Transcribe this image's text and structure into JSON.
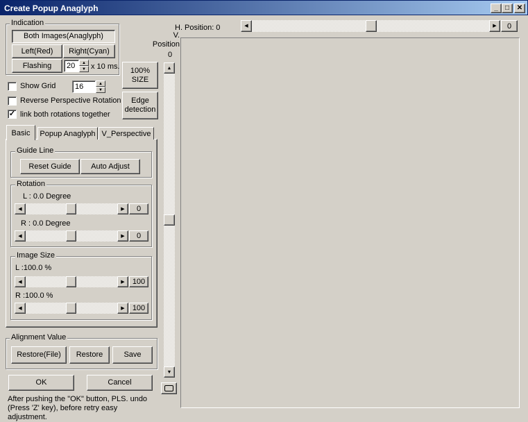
{
  "window": {
    "title": "Create Popup Anaglyph",
    "minimize_glyph": "_",
    "maximize_glyph": "□",
    "close_glyph": "✕"
  },
  "indication": {
    "label": "Indication",
    "both_images": "Both Images(Anaglyph)",
    "left_red": "Left(Red)",
    "right_cyan": "Right(Cyan)",
    "flashing": "Flashing",
    "flash_interval": "20",
    "flash_unit": "x 10 ms."
  },
  "buttons": {
    "size_100": "100% SIZE",
    "edge_detection": "Edge detection",
    "ok": "OK",
    "cancel": "Cancel"
  },
  "options": {
    "show_grid": "Show Grid",
    "show_grid_checked": false,
    "grid_size": "16",
    "reverse_rotation": "Reverse Perspective Rotation",
    "reverse_rotation_checked": false,
    "link_rotations": "link both rotations together",
    "link_rotations_checked": true
  },
  "tabs": [
    "Basic",
    "Popup Anaglyph",
    "V_Perspective"
  ],
  "guide_line": {
    "label": "Guide Line",
    "reset": "Reset Guide",
    "auto_adjust": "Auto Adjust"
  },
  "rotation": {
    "label": "Rotation",
    "left_label": "L : 0.0 Degree",
    "left_value": "0",
    "right_label": "R : 0.0 Degree",
    "right_value": "0"
  },
  "image_size": {
    "label": "Image Size",
    "left_label": "L :100.0 %",
    "left_value": "100",
    "right_label": "R :100.0 %",
    "right_value": "100"
  },
  "alignment": {
    "label": "Alignment Value",
    "restore_file": "Restore(File)",
    "restore": "Restore",
    "save": "Save"
  },
  "position": {
    "h_label": "H. Position:  0",
    "h_value": "0",
    "v_label": "V. Position",
    "v_value": "0"
  },
  "footer_note": "After pushing the \"OK\" button, PLS. undo (Press 'Z' key), before retry easy adjustment."
}
